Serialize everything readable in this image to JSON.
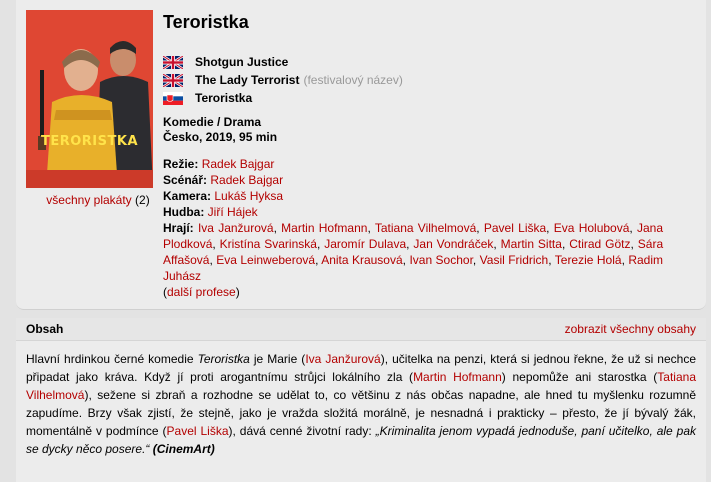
{
  "film": {
    "title": "Teroristka",
    "all_posters_label": "všechny plakáty",
    "all_posters_count": "(2)",
    "poster_title": "TERORISTKA",
    "alt_titles": [
      {
        "flag": "uk-flag",
        "name": "Shotgun Justice",
        "note": ""
      },
      {
        "flag": "uk-flag",
        "name": "The Lady Terrorist",
        "note": "(festivalový název)"
      },
      {
        "flag": "slovak-flag",
        "name": "Teroristka",
        "note": ""
      }
    ],
    "genre": "Komedie / Drama",
    "origin": "Česko, 2019, 95 min"
  },
  "creators": {
    "directing_label": "Režie:",
    "directing": [
      "Radek Bajgar"
    ],
    "screenplay_label": "Scénář:",
    "screenplay": [
      "Radek Bajgar"
    ],
    "camera_label": "Kamera:",
    "camera": [
      "Lukáš Hyksa"
    ],
    "music_label": "Hudba:",
    "music": [
      "Jiří Hájek"
    ],
    "cast_label": "Hrají:",
    "cast": [
      "Iva Janžurová",
      "Martin Hofmann",
      "Tatiana Vilhelmová",
      "Pavel Liška",
      "Eva Holubová",
      "Jana Plodková",
      "Kristína Svarinská",
      "Jaromír Dulava",
      "Jan Vondráček",
      "Martin Sitta",
      "Ctirad Götz",
      "Sára Affašová",
      "Eva Leinweberová",
      "Anita Krausová",
      "Ivan Sochor",
      "Vasil Fridrich",
      "Terezie Holá",
      "Radim Juhász"
    ],
    "more_professions_open": "(",
    "more_professions": "další profese",
    "more_professions_close": ")"
  },
  "synopsis": {
    "header": "Obsah",
    "show_all": "zobrazit všechny obsahy",
    "t1": "Hlavní hrdinkou černé komedie ",
    "t1_em": "Teroristka",
    "t2": " je Marie (",
    "link1": "Iva Janžurová",
    "t3": "), učitelka na penzi, která si jednou řekne, že už si nechce připadat jako kráva. Když jí proti arogantnímu strůjci lokálního zla (",
    "link2": "Martin Hofmann",
    "t4": ") nepomůže ani starostka (",
    "link3": "Tatiana Vilhelmová",
    "t5": "), sežene si zbraň a rozhodne se udělat to, co většinu z nás občas napadne, ale hned tu myšlenku rozumně zapudíme. Brzy však zjistí, že stejně, jako je vražda složitá morálně, je nesnadná i prakticky – přesto, že jí bývalý žák, momentálně v podmínce (",
    "link4": "Pavel Liška",
    "t6": "), dává cenné životní rady: ",
    "quote": "„Kriminalita jenom vypadá jednoduše, paní učitelko, ale pak se dycky něco posere.“",
    "source": "(CinemArt)"
  }
}
